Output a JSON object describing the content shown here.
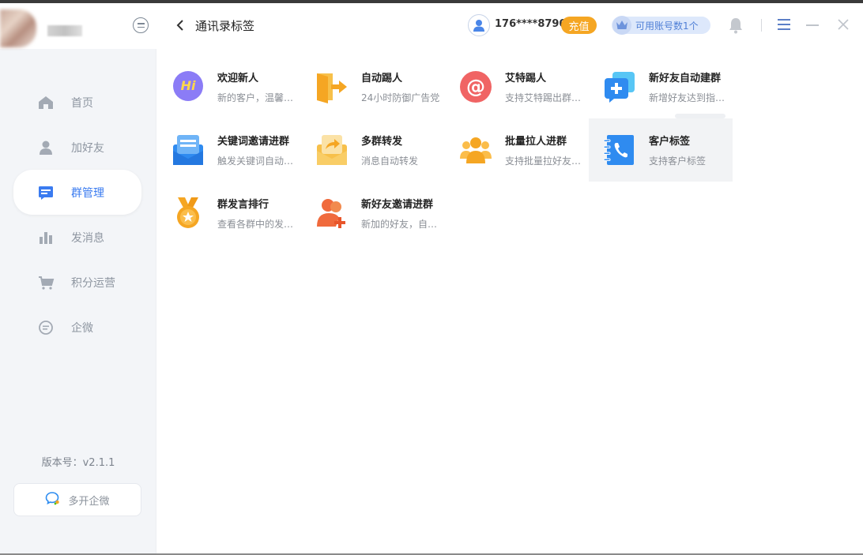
{
  "header": {
    "title": "通讯录标签",
    "phone": "176****8790",
    "recharge_label": "充值",
    "accounts_label": "可用账号数1个"
  },
  "sidebar": {
    "items": [
      {
        "label": "首页",
        "icon": "home-icon"
      },
      {
        "label": "加好友",
        "icon": "user-icon"
      },
      {
        "label": "群管理",
        "icon": "group-manage-icon",
        "active": true
      },
      {
        "label": "发消息",
        "icon": "bar-chart-icon"
      },
      {
        "label": "积分运营",
        "icon": "cart-icon"
      },
      {
        "label": "企微",
        "icon": "chat-bubble-icon"
      }
    ],
    "version": "版本号：v2.1.1",
    "multi_open_label": "多开企微"
  },
  "features": [
    {
      "title": "欢迎新人",
      "desc": "新的客户，温馨…",
      "icon": "hi-bubble-icon"
    },
    {
      "title": "自动踢人",
      "desc": "24小时防御广告党",
      "icon": "exit-door-icon"
    },
    {
      "title": "艾特踢人",
      "desc": "支持艾特踢出群…",
      "icon": "at-sign-icon"
    },
    {
      "title": "新好友自动建群",
      "desc": "新增好友达到指…",
      "icon": "add-group-icon"
    },
    {
      "title": "关键词邀请进群",
      "desc": "触发关键词自动…",
      "icon": "mail-list-icon"
    },
    {
      "title": "多群转发",
      "desc": "消息自动转发",
      "icon": "forward-envelope-icon"
    },
    {
      "title": "批量拉人进群",
      "desc": "支持批量拉好友…",
      "icon": "people-group-icon"
    },
    {
      "title": "客户标签",
      "desc": "支持客户标签",
      "icon": "phone-book-icon"
    },
    {
      "title": "群发言排行",
      "desc": "查看各群中的发…",
      "icon": "medal-icon"
    },
    {
      "title": "新好友邀请进群",
      "desc": "新加的好友，自…",
      "icon": "add-friend-icon"
    }
  ],
  "colors": {
    "accent": "#3a7bf0",
    "recharge": "#f5a623",
    "sidebar_bg": "#f3f5f8"
  }
}
